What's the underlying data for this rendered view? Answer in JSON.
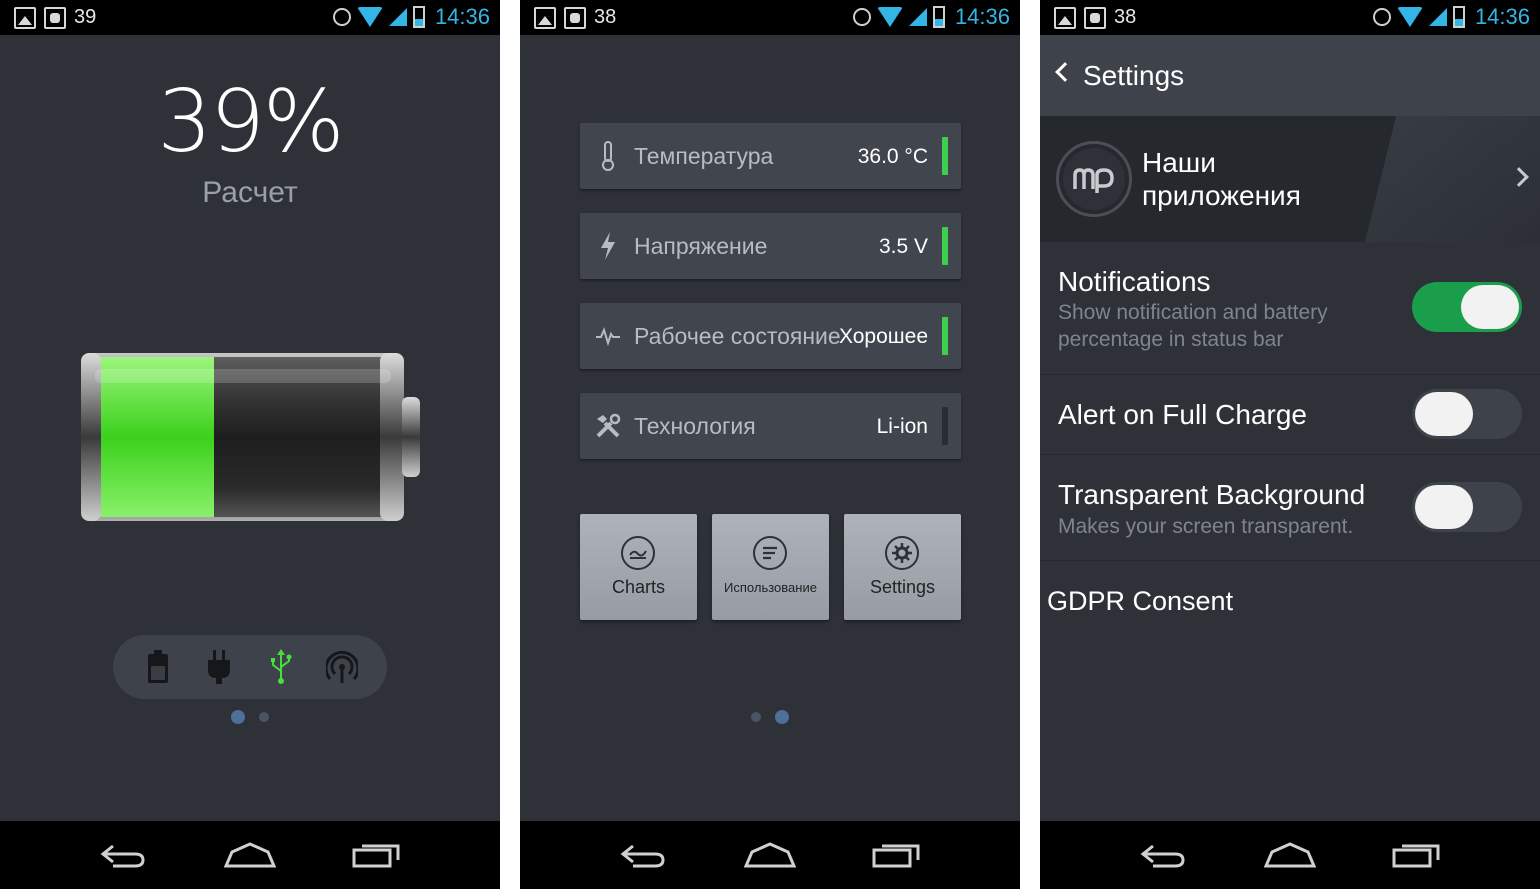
{
  "screens": [
    {
      "status": {
        "notif_count": "39",
        "time": "14:36"
      },
      "battery": {
        "percent_text": "39%",
        "state_label": "Расчет",
        "level": 0.39
      },
      "charge_modes": [
        "battery-icon",
        "plug-icon",
        "usb-icon",
        "wireless-icon"
      ],
      "active_mode": "usb-icon",
      "page_indicator": {
        "current": 1,
        "total": 2
      }
    },
    {
      "status": {
        "notif_count": "38",
        "time": "14:36"
      },
      "rows": [
        {
          "label": "Температура",
          "value": "36.0 °C",
          "icon": "thermometer-icon",
          "ok": true
        },
        {
          "label": "Напряжение",
          "value": "3.5 V",
          "icon": "lightning-icon",
          "ok": true
        },
        {
          "label": "Рабочее состояние",
          "value": "Хорошее",
          "icon": "pulse-icon",
          "ok": true
        },
        {
          "label": "Технология",
          "value": "Li-ion",
          "icon": "tools-icon",
          "ok": false
        }
      ],
      "tiles": [
        {
          "label": "Charts",
          "icon": "chart-icon"
        },
        {
          "label": "Использование",
          "icon": "usage-icon"
        },
        {
          "label": "Settings",
          "icon": "gear-icon"
        }
      ],
      "page_indicator": {
        "current": 2,
        "total": 2
      }
    },
    {
      "status": {
        "notif_count": "38",
        "time": "14:36"
      },
      "header": {
        "title": "Settings"
      },
      "promo": {
        "title": "Наши приложения"
      },
      "settings": [
        {
          "title": "Notifications",
          "description": "Show notification and battery percentage in status bar",
          "enabled": true
        },
        {
          "title": "Alert on Full Charge",
          "description": "",
          "enabled": false
        },
        {
          "title": "Transparent Background",
          "description": "Makes your screen transparent.",
          "enabled": false
        }
      ],
      "gdpr": "GDPR Consent"
    }
  ],
  "colors": {
    "accent_green": "#3ecf4e",
    "toggle_on": "#1a9e4b",
    "status_blue": "#33b5e5",
    "background": "#2e3137"
  }
}
